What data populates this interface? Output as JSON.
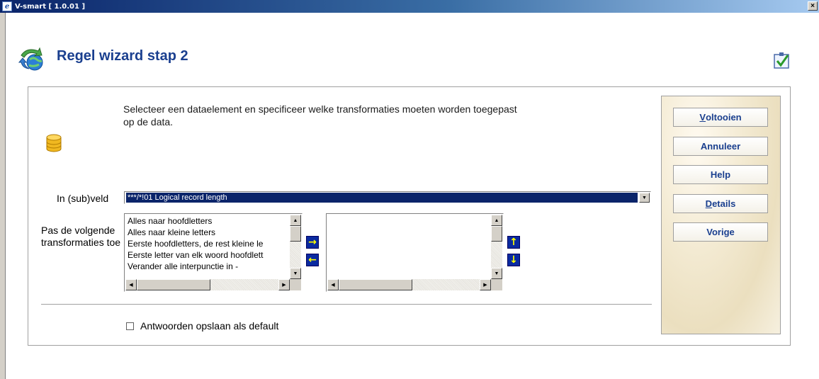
{
  "window": {
    "title": "V-smart [ 1.0.01 ]",
    "close_glyph": "×"
  },
  "header": {
    "title": "Regel wizard stap 2"
  },
  "main": {
    "instructions": "Selecteer een dataelement en specificeer welke transformaties moeten worden toegepast op de data.",
    "field_label": "In (sub)veld",
    "field_value": "***/*!01 Logical record length",
    "transform_label": "Pas de volgende transformaties toe",
    "available_transformations": [
      "Alles naar hoofdletters",
      "Alles naar kleine letters",
      "Eerste hoofdletters, de rest kleine le",
      "Eerste letter van elk woord hoofdlett",
      "Verander alle interpunctie in -"
    ],
    "selected_transformations": [],
    "move_right_glyph": "→",
    "move_left_glyph": "←",
    "move_up_glyph": "↑",
    "move_down_glyph": "↓",
    "checkbox": {
      "label": "Antwoorden opslaan als default",
      "checked": false
    }
  },
  "actions": {
    "finish": {
      "hotkey": "V",
      "rest": "oltooien"
    },
    "cancel": "Annuleer",
    "help": "Help",
    "details": {
      "hotkey": "D",
      "rest": "etails"
    },
    "previous": "Vorige"
  },
  "scroll_glyphs": {
    "up": "▲",
    "down": "▼",
    "left": "◀",
    "right": "▶"
  },
  "colors": {
    "accent": "#1a3f8f",
    "selection": "#0a246a",
    "arrow_button": "#0a2aa0",
    "arrow_glyph": "#ffff00"
  },
  "icons": [
    "ie-icon",
    "close-icon",
    "refresh-globe-icon",
    "wizard-check-icon",
    "database-icon"
  ]
}
